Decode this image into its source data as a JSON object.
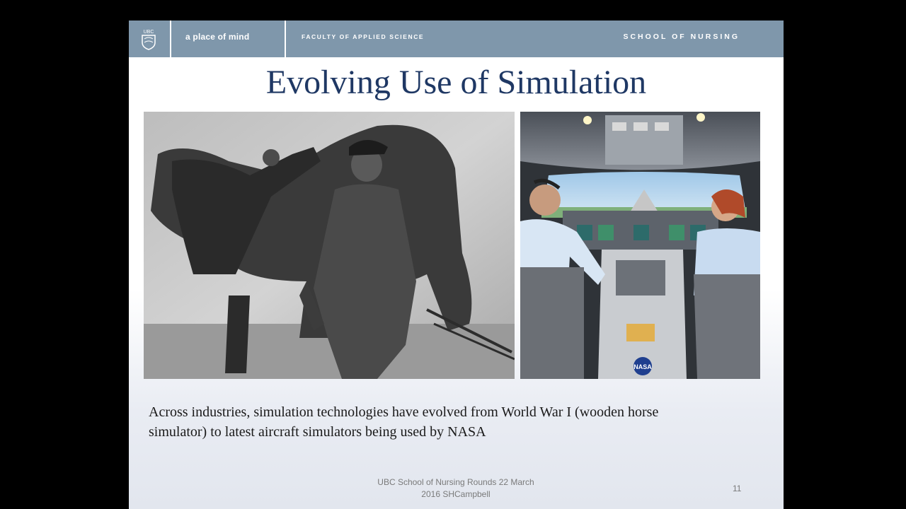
{
  "banner": {
    "logo_text": "UBC",
    "tagline": "a place of mind",
    "faculty": "FACULTY OF APPLIED SCIENCE",
    "school": "SCHOOL OF NURSING"
  },
  "slide": {
    "title": "Evolving Use of Simulation",
    "caption_line1": "Across industries, simulation technologies have evolved from World War I (wooden horse",
    "caption_line2": "simulator) to latest aircraft simulators being used by NASA",
    "footer_line1": "UBC School of Nursing Rounds 22 March",
    "footer_line2": "2016 SHCampbell",
    "page_number": "11"
  },
  "images": {
    "left": "wooden-horse-simulator-photo",
    "right": "nasa-flight-simulator-cockpit-photo",
    "nasa_logo_text": "NASA"
  },
  "colors": {
    "banner": "#7f97ab",
    "title": "#1f3864",
    "background": "#000000"
  }
}
